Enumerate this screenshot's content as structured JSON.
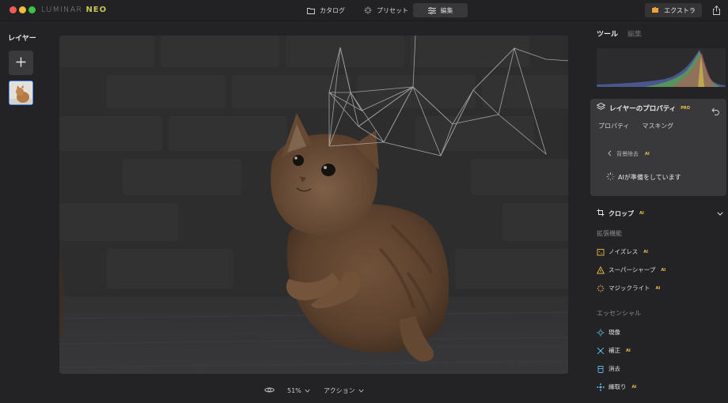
{
  "app": {
    "brand_light": "LUMINAR",
    "brand_bold": "NEO"
  },
  "header": {
    "tabs": [
      {
        "label": "カタログ",
        "icon": "folder-icon",
        "active": false
      },
      {
        "label": "プリセット",
        "icon": "sparkle-icon",
        "active": false
      },
      {
        "label": "編集",
        "icon": "sliders-icon",
        "active": true
      }
    ],
    "extra_label": "エクストラ",
    "share_icon": "share-icon"
  },
  "left_panel": {
    "title": "レイヤー",
    "add_icon": "plus-icon",
    "thumbnail": "cat-photo-thumbnail"
  },
  "bottom_bar": {
    "zoom": "51%",
    "action_label": "アクション",
    "eye_icon": "eye-icon"
  },
  "right_panel": {
    "tabs": [
      {
        "label": "ツール",
        "active": true
      },
      {
        "label": "編集",
        "active": false
      }
    ],
    "layer_properties": {
      "title": "レイヤーのプロパティ",
      "badge": "PRO",
      "subtabs": [
        "プロパティ",
        "マスキング"
      ],
      "back_label": "背景除去",
      "back_badge": "AI",
      "status": "AIが準備をしています"
    },
    "crop": {
      "label": "クロップ",
      "badge": "AI"
    },
    "sections": [
      {
        "title": "拡張機能",
        "items": [
          {
            "label": "ノイズレス",
            "badge": "AI",
            "icon": "noiseless-icon"
          },
          {
            "label": "スーパーシャープ",
            "badge": "AI",
            "icon": "supersharp-icon"
          },
          {
            "label": "マジックライト",
            "badge": "AI",
            "icon": "magic-light-icon"
          }
        ]
      },
      {
        "title": "エッセンシャル",
        "items": [
          {
            "label": "現像",
            "badge": "",
            "icon": "develop-icon"
          },
          {
            "label": "補正",
            "badge": "AI",
            "icon": "enhance-icon"
          },
          {
            "label": "消去",
            "badge": "",
            "icon": "erase-icon"
          },
          {
            "label": "縁取り",
            "badge": "AI",
            "icon": "structure-icon"
          }
        ]
      }
    ]
  },
  "colors": {
    "background": "#232325",
    "panel": "#39393b",
    "accent_blue": "#4d8ff0",
    "ai_badge": "#e9c04a",
    "extra_accent": "#f0a33a"
  }
}
